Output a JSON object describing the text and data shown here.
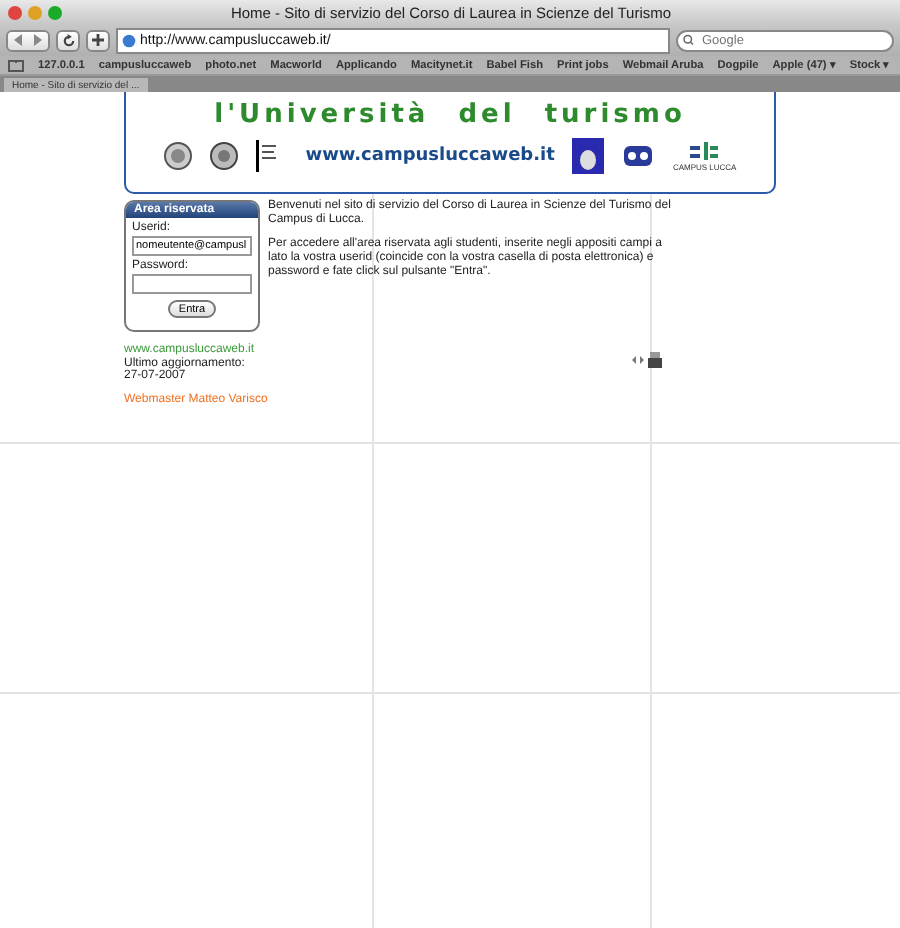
{
  "window": {
    "title": "Home - Sito di servizio del Corso di Laurea in Scienze del Turismo"
  },
  "toolbar": {
    "url": "http://www.campusluccaweb.it/",
    "search": {
      "placeholder": "Google"
    }
  },
  "bookmarks": [
    "127.0.0.1",
    "campusluccaweb",
    "photo.net",
    "Macworld",
    "Applicando",
    "Macitynet.it",
    "Babel Fish",
    "Print jobs",
    "Webmail Aruba",
    "Dogpile",
    "Apple (47) ▾",
    "Stock ▾"
  ],
  "tabs": [
    {
      "label": "Home - Sito di servizio del ...",
      "selected": true
    }
  ],
  "banner": {
    "title": "l'Università del turismo",
    "site_url": "www.campusluccaweb.it",
    "logo_caption": "CAMPUS LUCCA"
  },
  "login": {
    "heading": "Area riservata",
    "userid_label": "Userid:",
    "userid_value": "nomeutente@campusl",
    "password_label": "Password:",
    "button": "Entra"
  },
  "content": {
    "paragraphs": [
      "Benvenuti nel sito di servizio del Corso di Laurea in Scienze del Turismo del Campus di Lucca.",
      "Per accedere all'area riservata agli studenti, inserite negli appositi campi a lato la vostra userid (coincide con la vostra casella di posta elettronica) e password e fate click sul pulsante \"Entra\"."
    ]
  },
  "footer": {
    "site_link": "www.campusluccaweb.it",
    "updated_label": "Ultimo aggiornamento:",
    "updated_date": "27-07-2007",
    "webmaster": "Webmaster Matteo Varisco"
  }
}
